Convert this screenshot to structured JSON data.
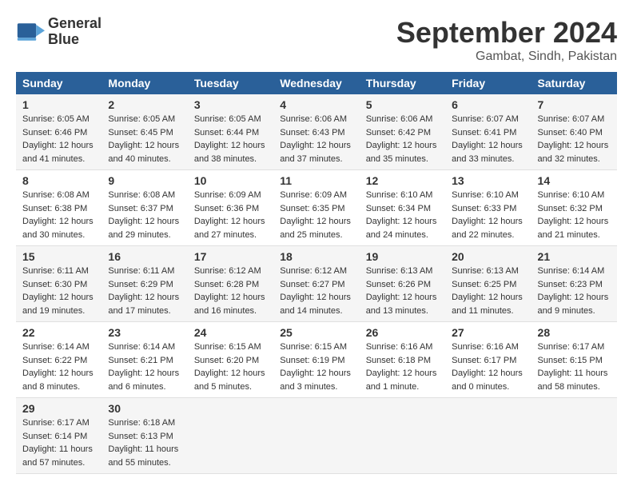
{
  "logo": {
    "line1": "General",
    "line2": "Blue"
  },
  "title": "September 2024",
  "location": "Gambat, Sindh, Pakistan",
  "days_of_week": [
    "Sunday",
    "Monday",
    "Tuesday",
    "Wednesday",
    "Thursday",
    "Friday",
    "Saturday"
  ],
  "weeks": [
    [
      {
        "day": "1",
        "sunrise": "6:05 AM",
        "sunset": "6:46 PM",
        "daylight": "12 hours and 41 minutes."
      },
      {
        "day": "2",
        "sunrise": "6:05 AM",
        "sunset": "6:45 PM",
        "daylight": "12 hours and 40 minutes."
      },
      {
        "day": "3",
        "sunrise": "6:05 AM",
        "sunset": "6:44 PM",
        "daylight": "12 hours and 38 minutes."
      },
      {
        "day": "4",
        "sunrise": "6:06 AM",
        "sunset": "6:43 PM",
        "daylight": "12 hours and 37 minutes."
      },
      {
        "day": "5",
        "sunrise": "6:06 AM",
        "sunset": "6:42 PM",
        "daylight": "12 hours and 35 minutes."
      },
      {
        "day": "6",
        "sunrise": "6:07 AM",
        "sunset": "6:41 PM",
        "daylight": "12 hours and 33 minutes."
      },
      {
        "day": "7",
        "sunrise": "6:07 AM",
        "sunset": "6:40 PM",
        "daylight": "12 hours and 32 minutes."
      }
    ],
    [
      {
        "day": "8",
        "sunrise": "6:08 AM",
        "sunset": "6:38 PM",
        "daylight": "12 hours and 30 minutes."
      },
      {
        "day": "9",
        "sunrise": "6:08 AM",
        "sunset": "6:37 PM",
        "daylight": "12 hours and 29 minutes."
      },
      {
        "day": "10",
        "sunrise": "6:09 AM",
        "sunset": "6:36 PM",
        "daylight": "12 hours and 27 minutes."
      },
      {
        "day": "11",
        "sunrise": "6:09 AM",
        "sunset": "6:35 PM",
        "daylight": "12 hours and 25 minutes."
      },
      {
        "day": "12",
        "sunrise": "6:10 AM",
        "sunset": "6:34 PM",
        "daylight": "12 hours and 24 minutes."
      },
      {
        "day": "13",
        "sunrise": "6:10 AM",
        "sunset": "6:33 PM",
        "daylight": "12 hours and 22 minutes."
      },
      {
        "day": "14",
        "sunrise": "6:10 AM",
        "sunset": "6:32 PM",
        "daylight": "12 hours and 21 minutes."
      }
    ],
    [
      {
        "day": "15",
        "sunrise": "6:11 AM",
        "sunset": "6:30 PM",
        "daylight": "12 hours and 19 minutes."
      },
      {
        "day": "16",
        "sunrise": "6:11 AM",
        "sunset": "6:29 PM",
        "daylight": "12 hours and 17 minutes."
      },
      {
        "day": "17",
        "sunrise": "6:12 AM",
        "sunset": "6:28 PM",
        "daylight": "12 hours and 16 minutes."
      },
      {
        "day": "18",
        "sunrise": "6:12 AM",
        "sunset": "6:27 PM",
        "daylight": "12 hours and 14 minutes."
      },
      {
        "day": "19",
        "sunrise": "6:13 AM",
        "sunset": "6:26 PM",
        "daylight": "12 hours and 13 minutes."
      },
      {
        "day": "20",
        "sunrise": "6:13 AM",
        "sunset": "6:25 PM",
        "daylight": "12 hours and 11 minutes."
      },
      {
        "day": "21",
        "sunrise": "6:14 AM",
        "sunset": "6:23 PM",
        "daylight": "12 hours and 9 minutes."
      }
    ],
    [
      {
        "day": "22",
        "sunrise": "6:14 AM",
        "sunset": "6:22 PM",
        "daylight": "12 hours and 8 minutes."
      },
      {
        "day": "23",
        "sunrise": "6:14 AM",
        "sunset": "6:21 PM",
        "daylight": "12 hours and 6 minutes."
      },
      {
        "day": "24",
        "sunrise": "6:15 AM",
        "sunset": "6:20 PM",
        "daylight": "12 hours and 5 minutes."
      },
      {
        "day": "25",
        "sunrise": "6:15 AM",
        "sunset": "6:19 PM",
        "daylight": "12 hours and 3 minutes."
      },
      {
        "day": "26",
        "sunrise": "6:16 AM",
        "sunset": "6:18 PM",
        "daylight": "12 hours and 1 minute."
      },
      {
        "day": "27",
        "sunrise": "6:16 AM",
        "sunset": "6:17 PM",
        "daylight": "12 hours and 0 minutes."
      },
      {
        "day": "28",
        "sunrise": "6:17 AM",
        "sunset": "6:15 PM",
        "daylight": "11 hours and 58 minutes."
      }
    ],
    [
      {
        "day": "29",
        "sunrise": "6:17 AM",
        "sunset": "6:14 PM",
        "daylight": "11 hours and 57 minutes."
      },
      {
        "day": "30",
        "sunrise": "6:18 AM",
        "sunset": "6:13 PM",
        "daylight": "11 hours and 55 minutes."
      },
      {
        "day": "",
        "sunrise": "",
        "sunset": "",
        "daylight": ""
      },
      {
        "day": "",
        "sunrise": "",
        "sunset": "",
        "daylight": ""
      },
      {
        "day": "",
        "sunrise": "",
        "sunset": "",
        "daylight": ""
      },
      {
        "day": "",
        "sunrise": "",
        "sunset": "",
        "daylight": ""
      },
      {
        "day": "",
        "sunrise": "",
        "sunset": "",
        "daylight": ""
      }
    ]
  ],
  "labels": {
    "sunrise": "Sunrise:",
    "sunset": "Sunset:",
    "daylight": "Daylight:"
  }
}
